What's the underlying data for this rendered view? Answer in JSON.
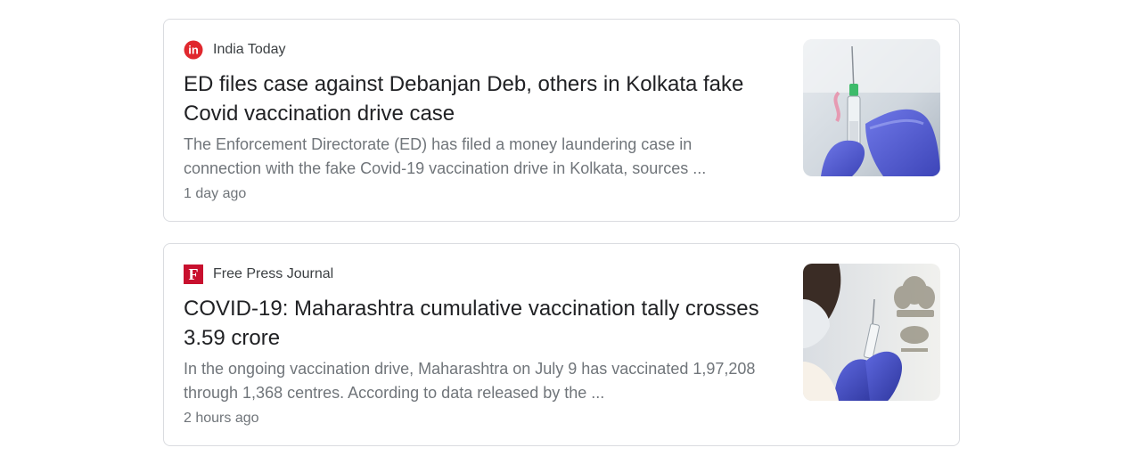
{
  "articles": [
    {
      "source": "India Today",
      "source_icon": "india-today-logo-icon",
      "brand_color": "#e0282e",
      "headline": "ED files case against Debanjan Deb, others in Kolkata fake Covid vaccination drive case",
      "snippet": "The Enforcement Directorate (ED) has filed a money laundering case in connection with the fake Covid-19 vaccination drive in Kolkata, sources ...",
      "time": "1 day ago",
      "logo_text": "in"
    },
    {
      "source": "Free Press Journal",
      "source_icon": "free-press-journal-logo-icon",
      "brand_color": "#c8102e",
      "headline": "COVID-19: Maharashtra cumulative vaccination tally crosses 3.59 crore",
      "snippet": "In the ongoing vaccination drive, Maharashtra on July 9 has vaccinated 1,97,208 through 1,368 centres. According to data released by the ...",
      "time": "2 hours ago",
      "logo_text": "F"
    }
  ],
  "colors": {
    "headline": "#202124",
    "snippet": "#70757a",
    "border": "#dadce0"
  }
}
